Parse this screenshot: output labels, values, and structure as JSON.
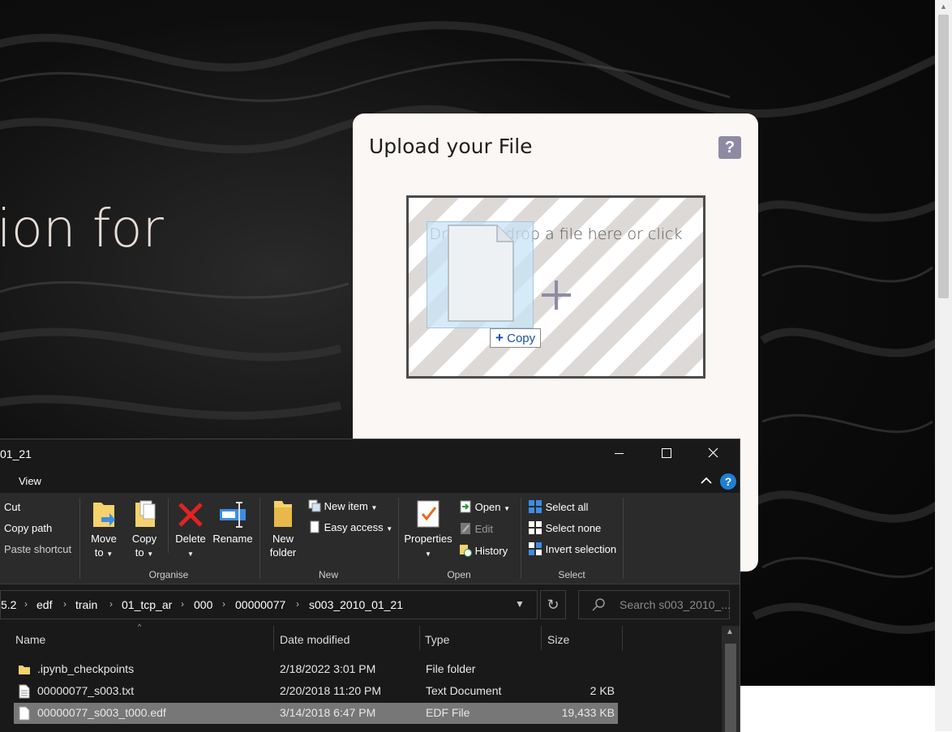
{
  "hero": {
    "heading": "ion for"
  },
  "upload": {
    "title": "Upload your File",
    "help": "?",
    "dropzone_text": "Drag and drop a file here or click",
    "copy_tooltip": "Copy"
  },
  "explorer": {
    "title": "01_21",
    "tabs": {
      "view": "View"
    },
    "help": "?",
    "clipboard": {
      "cut": "Cut",
      "copy_path": "Copy path",
      "paste_shortcut": "Paste shortcut"
    },
    "organise": {
      "label": "Organise",
      "move_to": [
        "Move",
        "to"
      ],
      "copy_to": [
        "Copy",
        "to"
      ],
      "delete": "Delete",
      "rename": "Rename"
    },
    "new": {
      "label": "New",
      "new_folder": [
        "New",
        "folder"
      ],
      "new_item": "New item",
      "easy_access": "Easy access"
    },
    "open": {
      "label": "Open",
      "properties": "Properties",
      "open": "Open",
      "edit": "Edit",
      "history": "History"
    },
    "select": {
      "label": "Select",
      "select_all": "Select all",
      "select_none": "Select none",
      "invert_selection": "Invert selection"
    },
    "breadcrumb": [
      "5.2",
      "edf",
      "train",
      "01_tcp_ar",
      "000",
      "00000077",
      "s003_2010_01_21"
    ],
    "search_placeholder": "Search s003_2010_...",
    "columns": {
      "name": "Name",
      "date": "Date modified",
      "type": "Type",
      "size": "Size"
    },
    "files": [
      {
        "name": ".ipynb_checkpoints",
        "date": "2/18/2022 3:01 PM",
        "type": "File folder",
        "size": "",
        "icon": "folder-icon"
      },
      {
        "name": "00000077_s003.txt",
        "date": "2/20/2018 11:20 PM",
        "type": "Text Document",
        "size": "2 KB",
        "icon": "text-file-icon"
      },
      {
        "name": "00000077_s003_t000.edf",
        "date": "3/14/2018 6:47 PM",
        "type": "EDF File",
        "size": "19,433 KB",
        "icon": "file-icon",
        "selected": true
      }
    ]
  },
  "colors": {
    "accent": "#8f8aa4",
    "selection": "#777777",
    "explorer_bg": "#191919"
  }
}
